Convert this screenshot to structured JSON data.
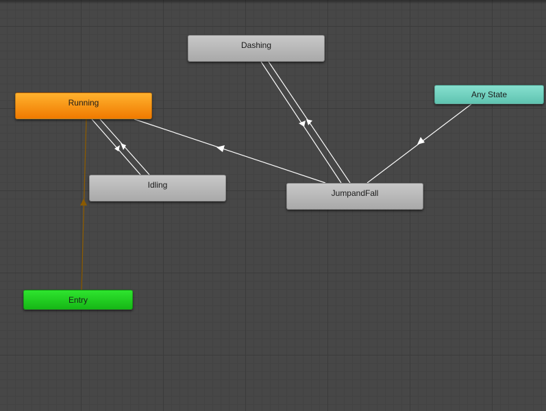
{
  "states": {
    "dashing": {
      "label": "Dashing"
    },
    "running": {
      "label": "Running"
    },
    "idling": {
      "label": "Idling"
    },
    "jumpandfall": {
      "label": "JumpandFall"
    },
    "any_state": {
      "label": "Any State"
    },
    "entry": {
      "label": "Entry"
    }
  },
  "transitions": [
    {
      "from": "Running",
      "to": "Idling"
    },
    {
      "from": "Idling",
      "to": "Running"
    },
    {
      "from": "Dashing",
      "to": "JumpandFall"
    },
    {
      "from": "JumpandFall",
      "to": "Dashing"
    },
    {
      "from": "JumpandFall",
      "to": "Running"
    },
    {
      "from": "Any State",
      "to": "JumpandFall"
    },
    {
      "from": "Entry",
      "to": "Running"
    }
  ],
  "colors": {
    "grid_background": "#474747",
    "default_state": "#b5b5b5",
    "active_state": "#f28c00",
    "entry_state": "#22cc22",
    "any_state": "#6fd1bf",
    "transition": "#ffffff",
    "entry_transition": "#8a5a00"
  }
}
